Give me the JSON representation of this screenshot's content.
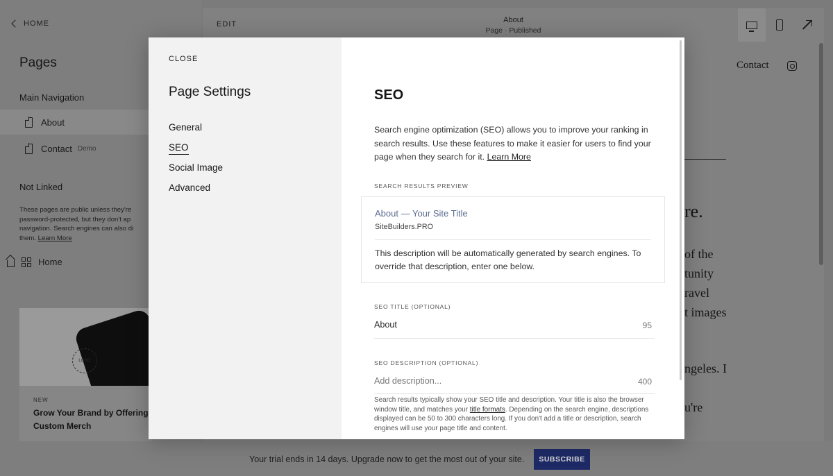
{
  "background": {
    "back_label": "HOME",
    "pages_title": "Pages",
    "main_navigation_heading": "Main Navigation",
    "nav_items": [
      {
        "label": "About",
        "badge": ""
      },
      {
        "label": "Contact",
        "badge": "Demo"
      }
    ],
    "not_linked_heading": "Not Linked",
    "not_linked_text": "These pages are public unless they're password-protected, but they don't ap navigation. Search engines can also di them.",
    "not_linked_link": "Learn More",
    "home_label": "Home",
    "promo": {
      "logo_text": "LOGO",
      "kicker": "NEW",
      "title": "Grow Your Brand by Offering Custom Merch"
    },
    "topbar": {
      "edit_label": "EDIT",
      "page_name": "About",
      "page_status": "Page · Published"
    },
    "site_preview": {
      "contact_link": "Contact",
      "fragments": [
        "re.",
        "of the",
        "tunity",
        "ravel",
        "t images",
        "ngeles. I",
        "u're"
      ]
    },
    "trial": {
      "text": "Your trial ends in 14 days. Upgrade now to get the most out of your site.",
      "subscribe_label": "SUBSCRIBE"
    }
  },
  "modal": {
    "close_label": "CLOSE",
    "title": "Page Settings",
    "nav": [
      "General",
      "SEO",
      "Social Image",
      "Advanced"
    ],
    "active_nav": "SEO",
    "seo": {
      "heading": "SEO",
      "intro": "Search engine optimization (SEO) allows you to improve your ranking in search results. Use these features to make it easier for users to find your page when they search for it.",
      "intro_link": "Learn More",
      "preview_label": "SEARCH RESULTS PREVIEW",
      "preview_title": "About — Your Site Title",
      "preview_url": "SiteBuilders.PRO",
      "preview_description": "This description will be automatically generated by search engines. To override that description, enter one below.",
      "title_label": "SEO TITLE (OPTIONAL)",
      "title_value": "About",
      "title_count": "95",
      "description_label": "SEO DESCRIPTION (OPTIONAL)",
      "description_placeholder": "Add description...",
      "description_count": "400",
      "help_text_1": "Search results typically show your SEO title and description. Your title is also the browser window title, and matches your",
      "help_link": "title formats",
      "help_text_2": ". Depending on the search engine, descriptions displayed can be 50 to 300 characters long. If you don't add a title or description, search engines will use your page title and content."
    }
  },
  "colors": {
    "overlay": "#7e7e7e",
    "modal_bg": "#ffffff",
    "modal_nav_bg": "#f2f2f2",
    "preview_link": "#5a6b91",
    "subscribe_bg": "#1e2a66"
  }
}
